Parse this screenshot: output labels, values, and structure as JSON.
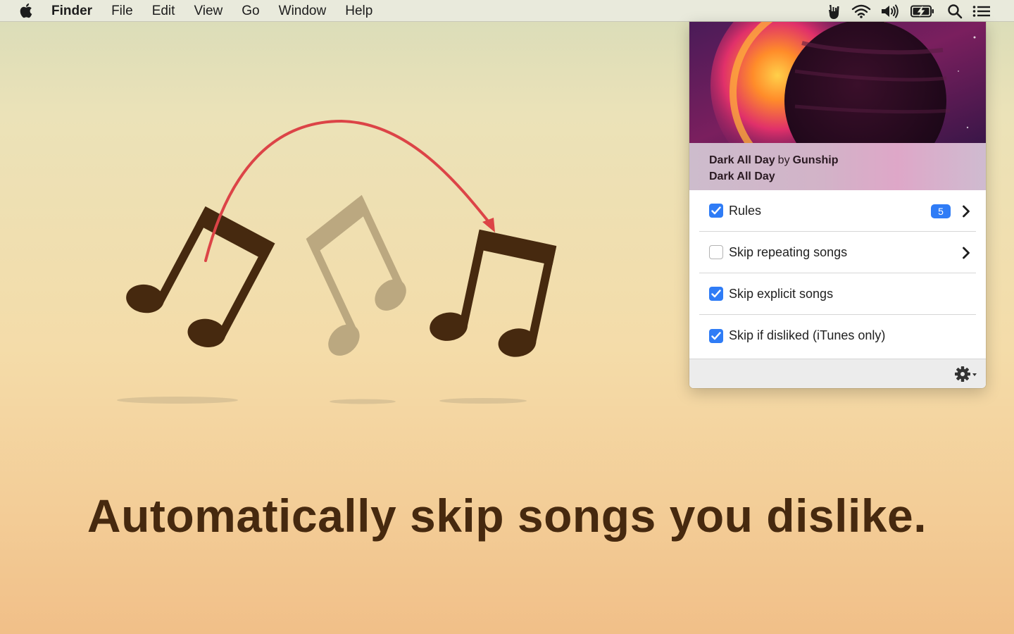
{
  "menubar": {
    "app_name": "Finder",
    "menus": [
      "File",
      "Edit",
      "View",
      "Go",
      "Window",
      "Help"
    ],
    "status_icons": [
      "rock-hand-icon",
      "wifi-icon",
      "volume-icon",
      "battery-icon",
      "search-icon",
      "list-icon"
    ]
  },
  "illustration": {
    "icons": [
      "music-note-icon",
      "music-note-icon",
      "music-note-icon",
      "skip-arrow-icon"
    ],
    "colors": {
      "note_dark": "#46290f",
      "note_faded": "#bba880",
      "arrow": "#dc4447"
    }
  },
  "tagline": "Automatically skip songs you dislike.",
  "popover": {
    "track": {
      "title": "Dark All Day",
      "by": "by",
      "artist": "Gunship",
      "album": "Dark All Day"
    },
    "options": [
      {
        "label": "Rules",
        "checked": true,
        "badge": "5",
        "has_chevron": true
      },
      {
        "label": "Skip repeating songs",
        "checked": false,
        "has_chevron": true
      },
      {
        "label": "Skip explicit songs",
        "checked": true,
        "has_chevron": false
      },
      {
        "label": "Skip if disliked (iTunes only)",
        "checked": true,
        "has_chevron": false
      }
    ],
    "footer": {
      "icon": "gear-dropdown-icon"
    },
    "accent_color": "#2f7cf6"
  }
}
